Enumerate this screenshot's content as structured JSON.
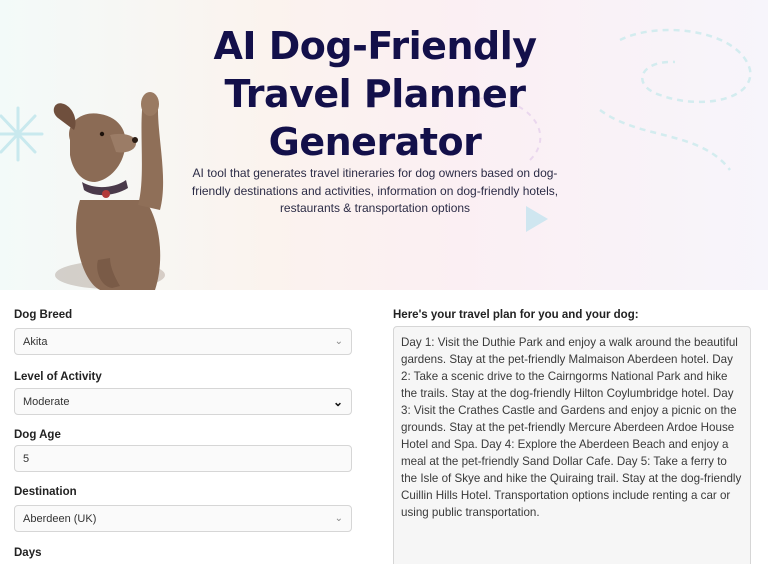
{
  "header": {
    "title": "AI Dog-Friendly Travel Planner Generator",
    "subtitle": "AI tool that generates travel itineraries for dog owners based on dog-friendly destinations and activities, information on dog-friendly hotels, restaurants & transportation options"
  },
  "form": {
    "breed_label": "Dog Breed",
    "breed_value": "Akita",
    "activity_label": "Level of Activity",
    "activity_value": "Moderate",
    "age_label": "Dog Age",
    "age_value": "5",
    "destination_label": "Destination",
    "destination_value": "Aberdeen (UK)",
    "days_label": "Days"
  },
  "result": {
    "label": "Here's your travel plan for you and your dog:",
    "text": "Day 1: Visit the Duthie Park and enjoy a walk around the beautiful gardens. Stay at the pet-friendly Malmaison Aberdeen hotel. Day 2: Take a scenic drive to the Cairngorms National Park and hike the trails. Stay at the dog-friendly Hilton Coylumbridge hotel. Day 3: Visit the Crathes Castle and Gardens and enjoy a picnic on the grounds. Stay at the pet-friendly Mercure Aberdeen Ardoe House Hotel and Spa. Day 4: Explore the Aberdeen Beach and enjoy a meal at the pet-friendly Sand Dollar Cafe. Day 5: Take a ferry to the Isle of Skye and hike the Quiraing trail. Stay at the dog-friendly Cuillin Hills Hotel. Transportation options include renting a car or using public transportation."
  },
  "icons": {
    "select_chevron": "chevron-down-icon",
    "dog_illustration": "dog-image"
  },
  "colors": {
    "title": "#13104a",
    "deco": "#bfe5ec"
  }
}
